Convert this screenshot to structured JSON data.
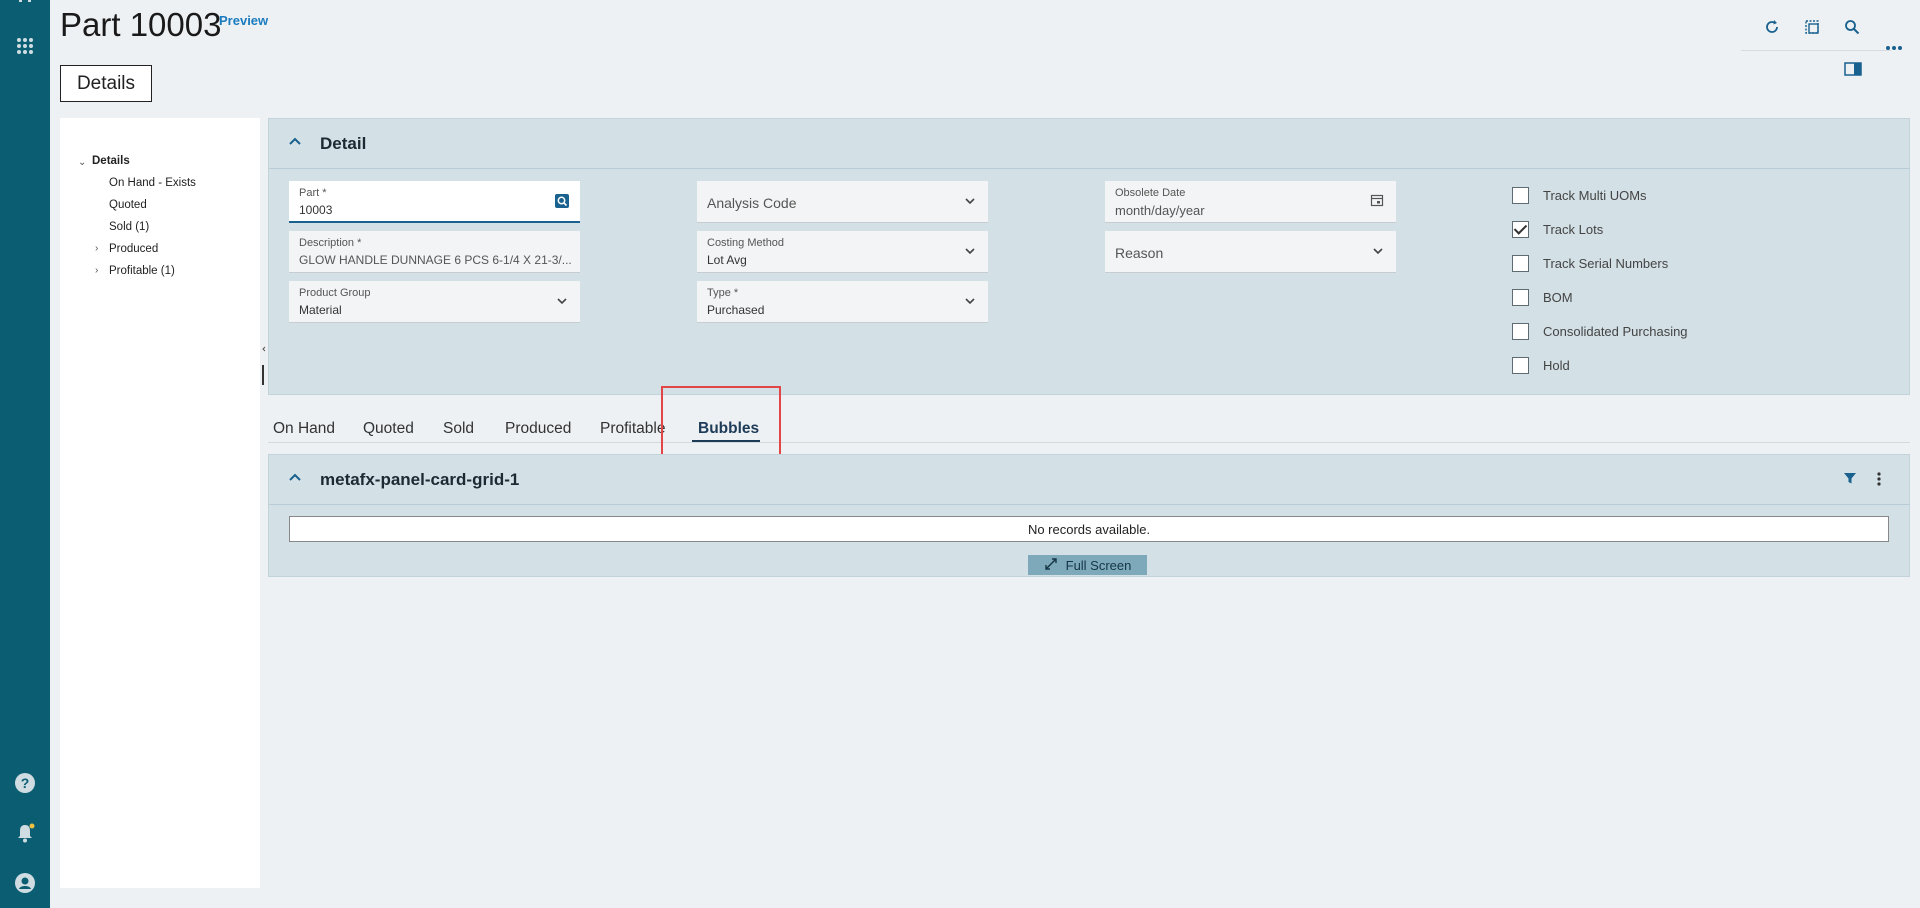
{
  "header": {
    "title": "Part 10003",
    "preview_link": "Preview",
    "details_button": "Details"
  },
  "tree": {
    "items": [
      {
        "label": "Details",
        "expanded": true
      },
      {
        "label": "On Hand - Exists"
      },
      {
        "label": "Quoted"
      },
      {
        "label": "Sold (1)"
      },
      {
        "label": "Produced",
        "expandable": true
      },
      {
        "label": "Profitable (1)",
        "expandable": true
      }
    ]
  },
  "detail": {
    "title": "Detail",
    "fields": {
      "part": {
        "label": "Part *",
        "value": "10003"
      },
      "description": {
        "label": "Description *",
        "value": "GLOW HANDLE DUNNAGE 6 PCS 6-1/4 X 21-3/..."
      },
      "product_group": {
        "label": "Product Group",
        "value": "Material"
      },
      "analysis_code": {
        "placeholder": "Analysis Code"
      },
      "costing_method": {
        "label": "Costing Method",
        "value": "Lot Avg"
      },
      "type": {
        "label": "Type *",
        "value": "Purchased"
      },
      "obsolete_date": {
        "label": "Obsolete Date",
        "placeholder": "month/day/year"
      },
      "reason": {
        "placeholder": "Reason"
      }
    },
    "checkboxes": [
      {
        "label": "Track Multi UOMs",
        "checked": false
      },
      {
        "label": "Track Lots",
        "checked": true
      },
      {
        "label": "Track Serial Numbers",
        "checked": false
      },
      {
        "label": "BOM",
        "checked": false
      },
      {
        "label": "Consolidated Purchasing",
        "checked": false
      },
      {
        "label": "Hold",
        "checked": false
      }
    ]
  },
  "tabs": [
    {
      "label": "On Hand"
    },
    {
      "label": "Quoted"
    },
    {
      "label": "Sold"
    },
    {
      "label": "Produced"
    },
    {
      "label": "Profitable"
    },
    {
      "label": "Bubbles",
      "active": true
    }
  ],
  "grid_panel": {
    "title": "metafx-panel-card-grid-1",
    "empty_text": "No records available.",
    "full_screen_label": "Full Screen"
  },
  "colors": {
    "rail": "#0b5e72",
    "accent": "#19618e",
    "panel": "#d3e0e6",
    "highlight": "#e24646"
  },
  "icons": {
    "rail_top": "grid-icon",
    "rail_bottom": [
      "help-icon",
      "bell-icon",
      "user-icon"
    ],
    "toolbar": [
      "refresh-icon",
      "copy-icon",
      "search-icon",
      "more-icon",
      "panel-toggle-icon"
    ]
  }
}
